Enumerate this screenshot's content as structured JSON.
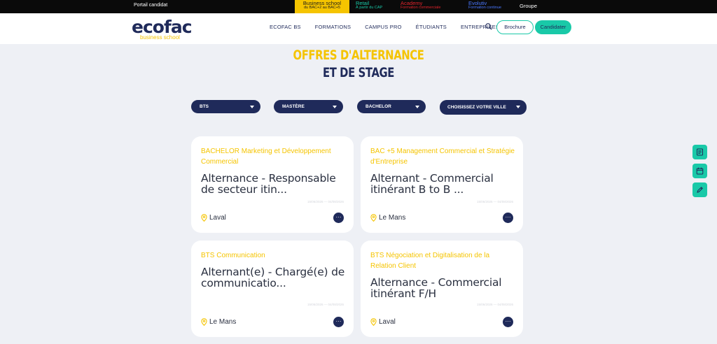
{
  "topbar": {
    "portal": "Portail candidat",
    "brands": [
      {
        "name": "Business school",
        "sub": "du BAC+2 au BAC+5"
      },
      {
        "name": "Retail",
        "sub": "À partir du CAP"
      },
      {
        "name": "Academy",
        "sub": "Formation commerciale"
      },
      {
        "name": "Evolutiv",
        "sub": "Formation continue"
      }
    ],
    "groupe": "Groupe"
  },
  "header": {
    "logo_text": "ecofac",
    "logo_tagline": "business school",
    "nav": [
      "ECOFAC BS",
      "FORMATIONS",
      "CAMPUS PRO",
      "ÉTUDIANTS",
      "ENTREPRISES"
    ],
    "brochure_label": "Brochure",
    "candidater_label": "Candidater"
  },
  "heading": {
    "line1": "OFFRES D'ALTERNANCE",
    "line2": "ET DE STAGE"
  },
  "filters": [
    "BTS",
    "MASTÈRE",
    "BACHELOR",
    "CHOISISSEZ VOTRE VILLE"
  ],
  "cards": [
    {
      "category": "BACHELOR Marketing et Développement Commercial",
      "title": "Alternance - Responsable de secteur itin...",
      "date": "15/06/2026 — 04/08/2026",
      "location": "Laval",
      "more": "···"
    },
    {
      "category": "BAC +5 Management Commercial et Stratégie d'Entreprise",
      "title": "Alternant - Commercial itinérant B to B ...",
      "date": "15/06/2026 — 04/08/2026",
      "location": "Le Mans",
      "more": "···"
    },
    {
      "category": "BTS Communication",
      "title": "Alternant(e) - Chargé(e) de communicatio...",
      "date": "15/06/2026 — 04/08/2026",
      "location": "Le Mans",
      "more": "···"
    },
    {
      "category": "BTS Négociation et Digitalisation de la Relation Client",
      "title": "Alternance - Commercial itinérant F/H",
      "date": "15/06/2026 — 04/08/2026",
      "location": "Laval",
      "more": "···"
    }
  ],
  "colors": {
    "navy": "#1f2a5a",
    "yellow": "#f5c400",
    "teal": "#19c9a8"
  }
}
